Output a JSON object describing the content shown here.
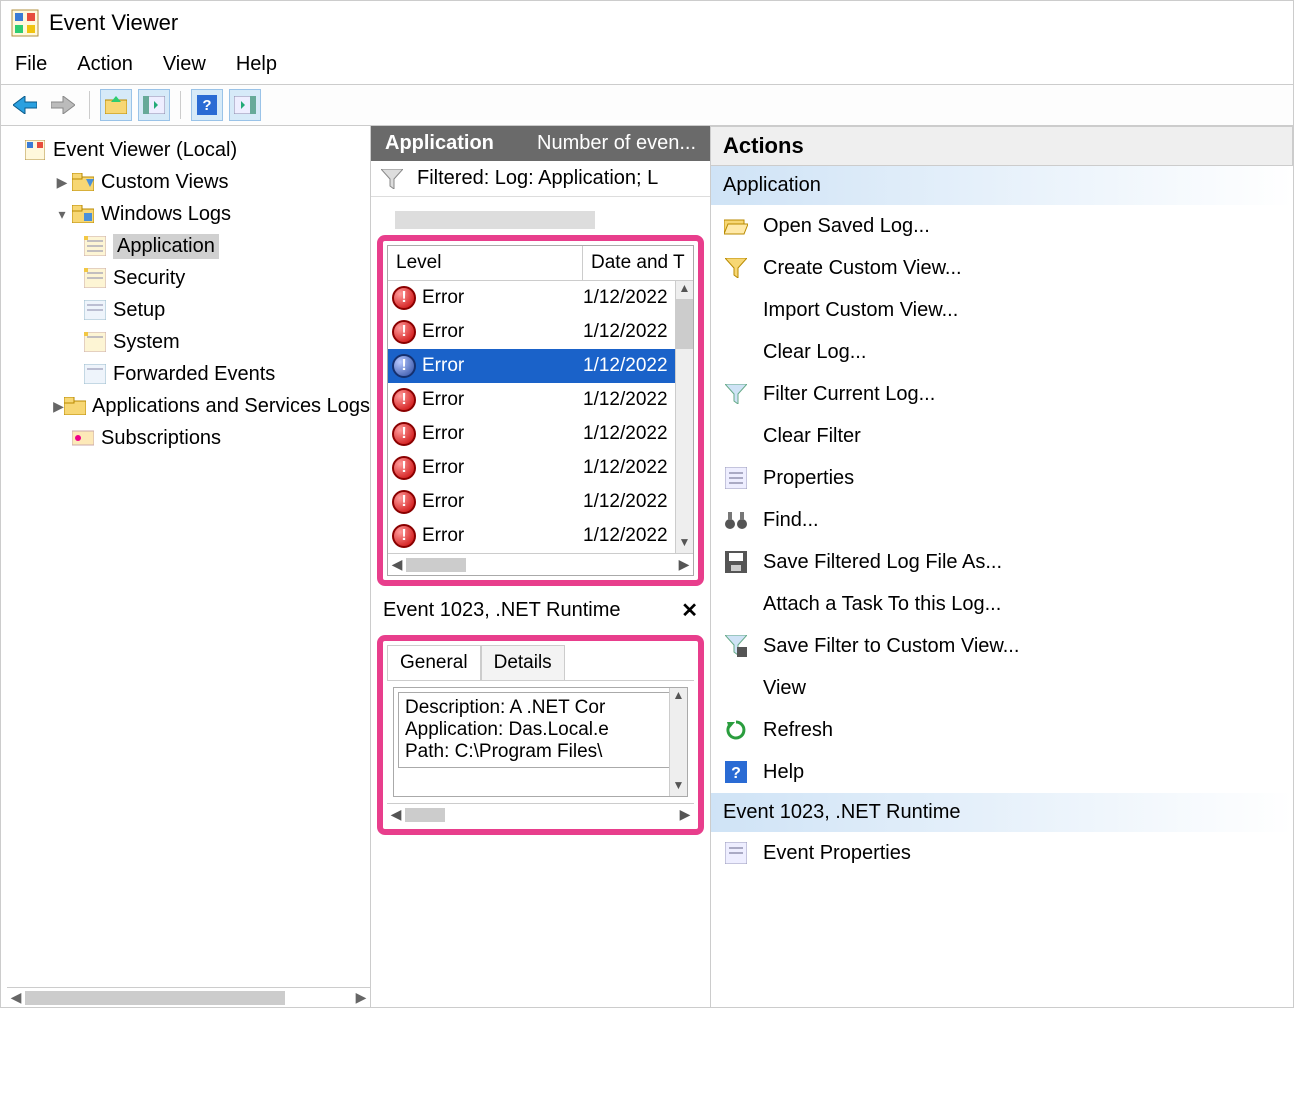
{
  "app": {
    "title": "Event Viewer"
  },
  "menu": {
    "file": "File",
    "action": "Action",
    "view": "View",
    "help": "Help"
  },
  "tree": {
    "root": "Event Viewer (Local)",
    "customViews": "Custom Views",
    "windowsLogs": "Windows Logs",
    "application": "Application",
    "security": "Security",
    "setup": "Setup",
    "system": "System",
    "forwarded": "Forwarded Events",
    "appsServices": "Applications and Services Logs",
    "subscriptions": "Subscriptions"
  },
  "center": {
    "headerTitle": "Application",
    "headerCount": "Number of even...",
    "filterText": "Filtered: Log: Application; L",
    "columns": {
      "level": "Level",
      "date": "Date and T"
    },
    "rows": [
      {
        "level": "Error",
        "date": "1/12/2022",
        "selected": false
      },
      {
        "level": "Error",
        "date": "1/12/2022",
        "selected": false
      },
      {
        "level": "Error",
        "date": "1/12/2022",
        "selected": true
      },
      {
        "level": "Error",
        "date": "1/12/2022",
        "selected": false
      },
      {
        "level": "Error",
        "date": "1/12/2022",
        "selected": false
      },
      {
        "level": "Error",
        "date": "1/12/2022",
        "selected": false
      },
      {
        "level": "Error",
        "date": "1/12/2022",
        "selected": false
      },
      {
        "level": "Error",
        "date": "1/12/2022",
        "selected": false
      }
    ],
    "detailTitle": "Event 1023, .NET Runtime",
    "tabs": {
      "general": "General",
      "details": "Details"
    },
    "detailLines": {
      "l1": "Description: A .NET Cor",
      "l2": "Application: Das.Local.e",
      "l3": "Path: C:\\Program Files\\"
    }
  },
  "actions": {
    "title": "Actions",
    "section1": "Application",
    "openSaved": "Open Saved Log...",
    "createCustom": "Create Custom View...",
    "importCustom": "Import Custom View...",
    "clearLog": "Clear Log...",
    "filterCurrent": "Filter Current Log...",
    "clearFilter": "Clear Filter",
    "properties": "Properties",
    "find": "Find...",
    "saveFiltered": "Save Filtered Log File As...",
    "attachTask": "Attach a Task To this Log...",
    "saveFilterCustom": "Save Filter to Custom View...",
    "view": "View",
    "refresh": "Refresh",
    "help": "Help",
    "section2": "Event 1023, .NET Runtime",
    "eventProps": "Event Properties"
  }
}
